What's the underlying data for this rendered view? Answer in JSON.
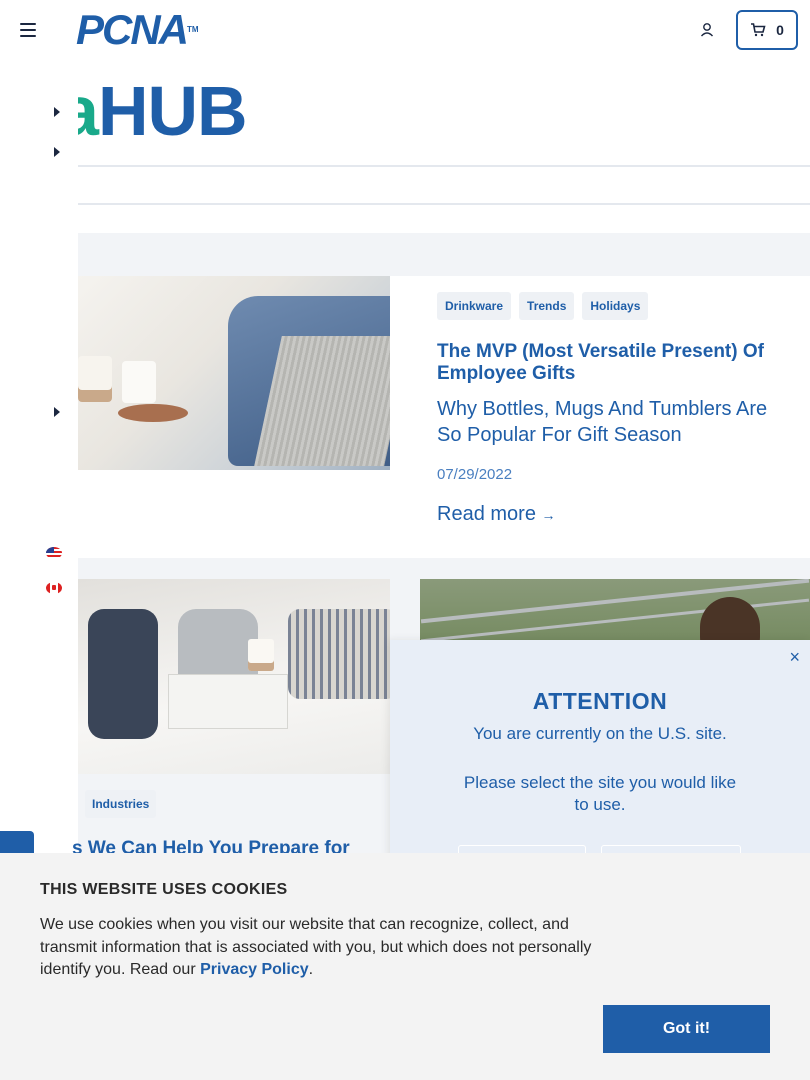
{
  "header": {
    "logo_text": "PCNA",
    "logo_tm": "TM",
    "cart_count": "0"
  },
  "hub": {
    "accent_text": "a",
    "title": "HUB"
  },
  "articles": [
    {
      "tags": [
        "Drinkware",
        "Trends",
        "Holidays"
      ],
      "title": "The MVP (Most Versatile Present) Of Employee Gifts",
      "subtitle": "Why Bottles, Mugs And Tumblers Are So Popular For Gift Season",
      "date": "07/29/2022",
      "read_more": "Read more",
      "read_more_arrow": "→"
    },
    {
      "tag": "Industries",
      "title": "s We Can Help You Prepare for"
    }
  ],
  "modal": {
    "close": "×",
    "title": "ATTENTION",
    "line1": "You are currently on the U.S. site.",
    "line2": "Please select the site you would like to use."
  },
  "cookie": {
    "title": "THIS WEBSITE USES COOKIES",
    "text": "We use cookies when you visit our website that can recognize, collect, and transmit information that is associated with you, but which does not personally identify you. Read our ",
    "link": "Privacy Policy",
    "period": ".",
    "button": "Got it!"
  },
  "colors": {
    "brand_blue": "#1f5ea8",
    "accent_green": "#19a98a",
    "cookie_bg": "#f3f3f3",
    "modal_bg": "#e8eef7"
  }
}
